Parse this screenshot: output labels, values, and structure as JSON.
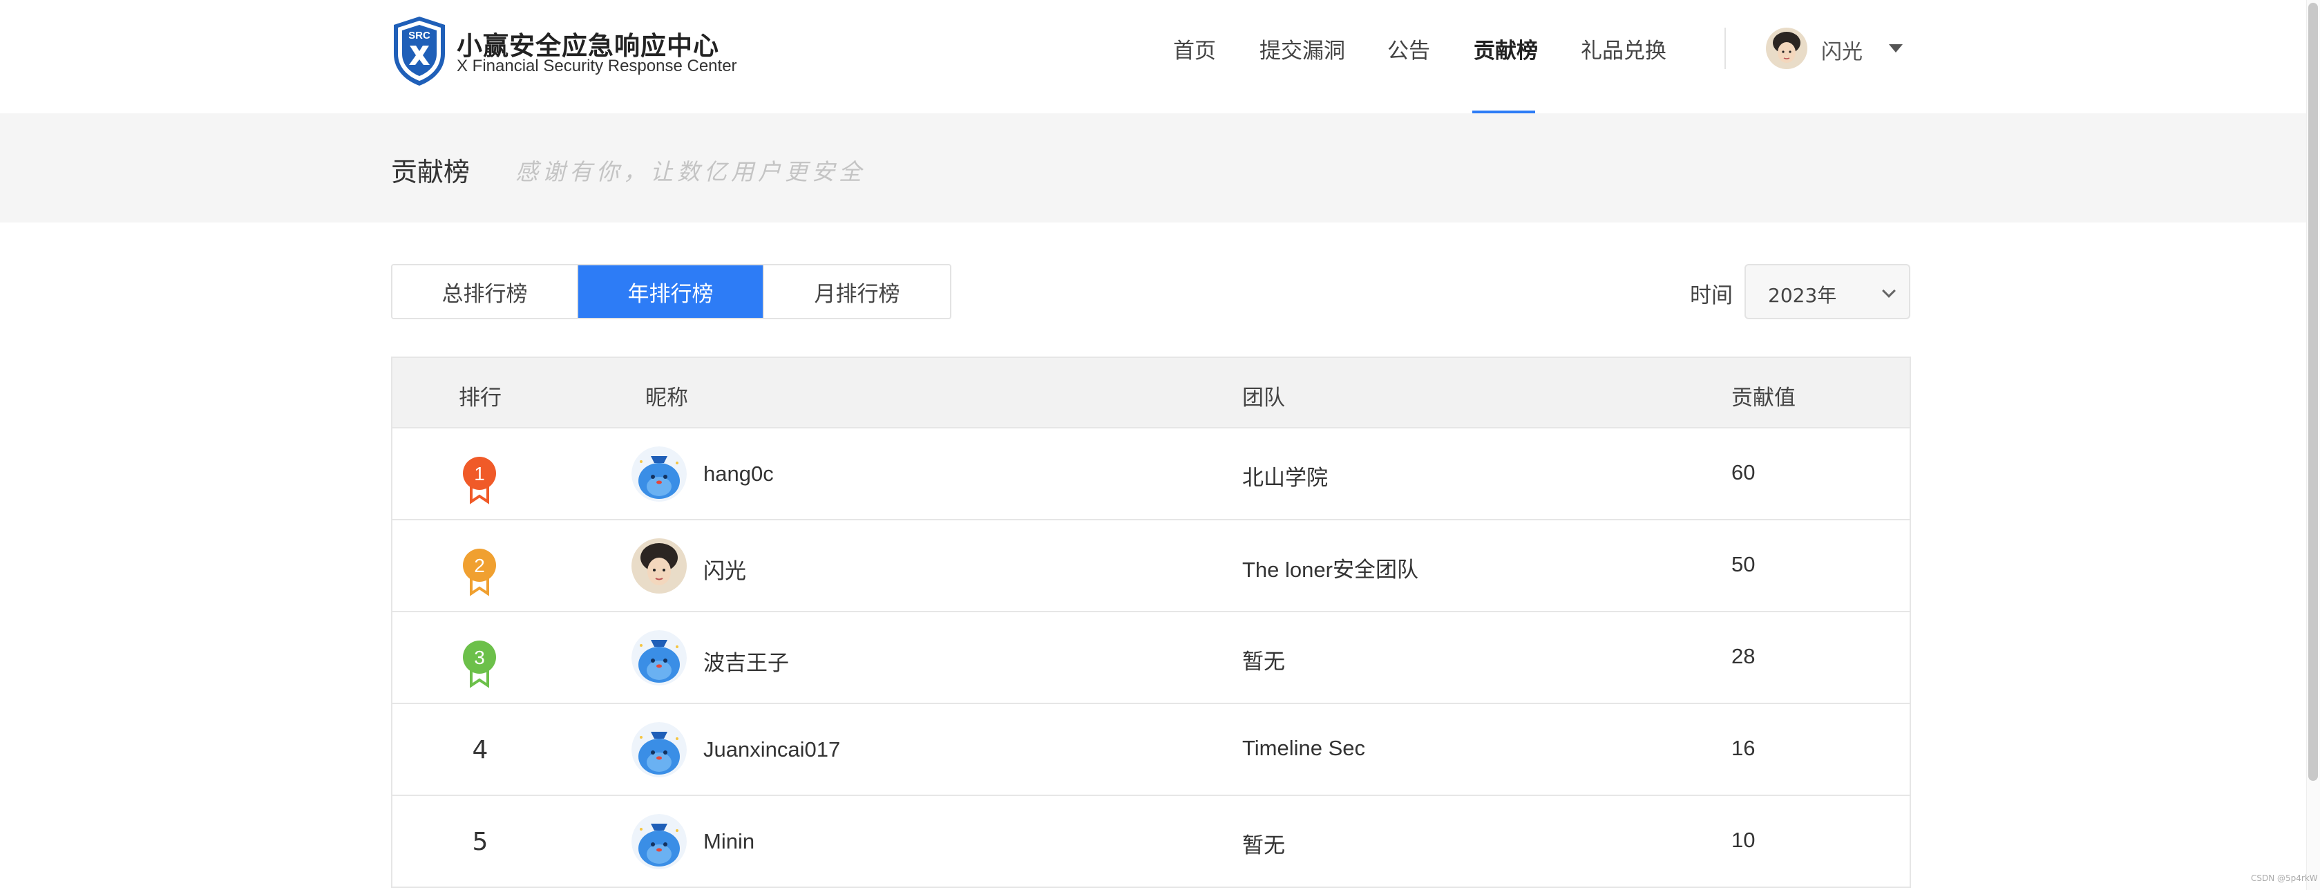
{
  "header": {
    "logo_badge_text": "SRC",
    "logo_title": "小赢安全应急响应中心",
    "logo_subtitle": "X Financial Security Response Center",
    "nav": [
      {
        "label": "首页",
        "active": false
      },
      {
        "label": "提交漏洞",
        "active": false
      },
      {
        "label": "公告",
        "active": false
      },
      {
        "label": "贡献榜",
        "active": true
      },
      {
        "label": "礼品兑换",
        "active": false
      }
    ],
    "user_name": "闪光"
  },
  "banner": {
    "title": "贡献榜",
    "slogan": "感谢有你，让数亿用户更安全"
  },
  "tabs": [
    {
      "label": "总排行榜",
      "active": false
    },
    {
      "label": "年排行榜",
      "active": true
    },
    {
      "label": "月排行榜",
      "active": false
    }
  ],
  "filter": {
    "time_label": "时间",
    "time_value": "2023年"
  },
  "table": {
    "headers": [
      "排行",
      "昵称",
      "团队",
      "贡献值"
    ],
    "rows": [
      {
        "rank": "1",
        "nickname": "hang0c",
        "team": "北山学院",
        "score": "60",
        "avatar": "mascot-avatar"
      },
      {
        "rank": "2",
        "nickname": "闪光",
        "team": "The loner安全团队",
        "score": "50",
        "avatar": "user-photo-avatar"
      },
      {
        "rank": "3",
        "nickname": "波吉王子",
        "team": "暂无",
        "score": "28",
        "avatar": "mascot-avatar"
      },
      {
        "rank": "4",
        "nickname": "Juanxincai017",
        "team": "Timeline Sec",
        "score": "16",
        "avatar": "mascot-avatar"
      },
      {
        "rank": "5",
        "nickname": "Minin",
        "team": "暂无",
        "score": "10",
        "avatar": "mascot-avatar"
      }
    ]
  },
  "colors": {
    "accent": "#2d7cf6",
    "medal_gold": "#f05a28",
    "medal_silver": "#f0a030",
    "medal_bronze": "#6cc04a"
  },
  "watermark": "CSDN @5p4rkW"
}
